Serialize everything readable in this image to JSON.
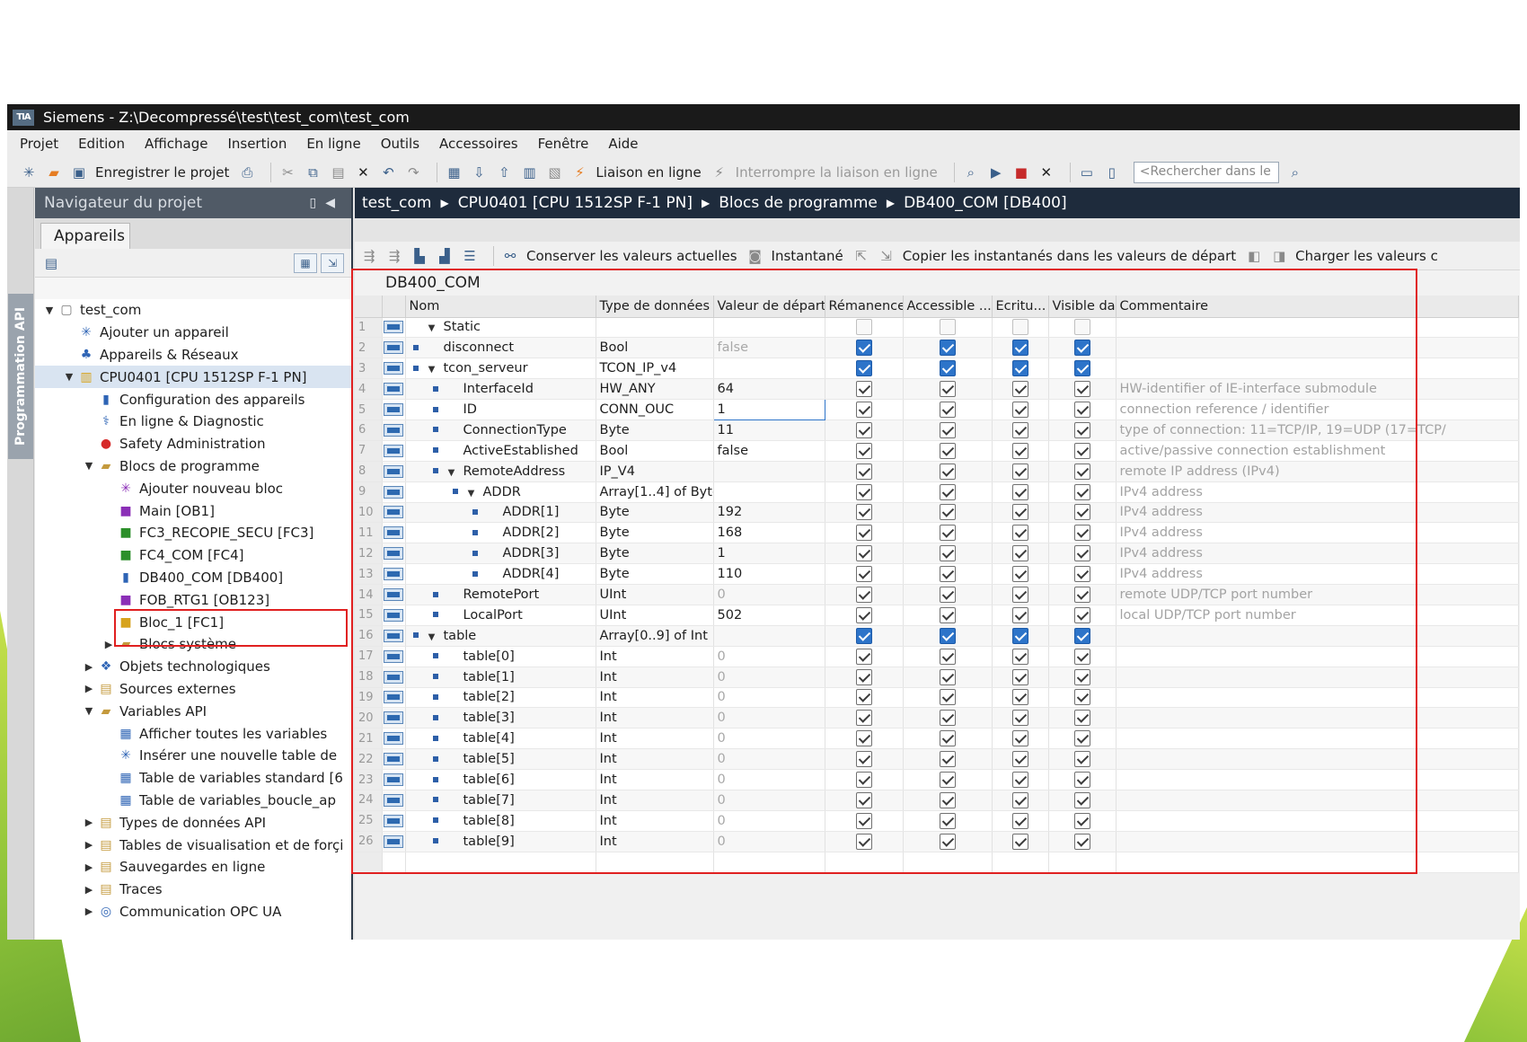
{
  "window": {
    "title": "Siemens  -  Z:\\Decompressé\\test\\test_com\\test_com",
    "logo": "TIA"
  },
  "menu": [
    "Projet",
    "Edition",
    "Affichage",
    "Insertion",
    "En ligne",
    "Outils",
    "Accessoires",
    "Fenêtre",
    "Aide"
  ],
  "toolbar": {
    "save_label": "Enregistrer le projet",
    "online_label": "Liaison en ligne",
    "offline_label": "Interrompre la liaison en ligne",
    "search_placeholder": "<Rechercher dans le"
  },
  "side_tab": {
    "label": "Programmation API"
  },
  "navigator": {
    "title": "Navigateur du projet",
    "tab": "Appareils",
    "tree": [
      {
        "label": "test_com",
        "level": 0,
        "arrow": "down",
        "icon": "project-icon"
      },
      {
        "label": "Ajouter un appareil",
        "level": 1,
        "arrow": "",
        "icon": "add-device-icon"
      },
      {
        "label": "Appareils & Réseaux",
        "level": 1,
        "arrow": "",
        "icon": "network-icon"
      },
      {
        "label": "CPU0401 [CPU 1512SP F-1 PN]",
        "level": 1,
        "arrow": "down",
        "icon": "cpu-icon",
        "selected": true
      },
      {
        "label": "Configuration des appareils",
        "level": 2,
        "arrow": "",
        "icon": "config-icon"
      },
      {
        "label": "En ligne & Diagnostic",
        "level": 2,
        "arrow": "",
        "icon": "diagnostic-icon"
      },
      {
        "label": "Safety Administration",
        "level": 2,
        "arrow": "",
        "icon": "safety-icon"
      },
      {
        "label": "Blocs de programme",
        "level": 2,
        "arrow": "down",
        "icon": "folder-icon"
      },
      {
        "label": "Ajouter nouveau bloc",
        "level": 3,
        "arrow": "",
        "icon": "add-block-icon"
      },
      {
        "label": "Main [OB1]",
        "level": 3,
        "arrow": "",
        "icon": "ob-icon"
      },
      {
        "label": "FC3_RECOPIE_SECU [FC3]",
        "level": 3,
        "arrow": "",
        "icon": "fc-icon"
      },
      {
        "label": "FC4_COM [FC4]",
        "level": 3,
        "arrow": "",
        "icon": "fc-icon"
      },
      {
        "label": "DB400_COM [DB400]",
        "level": 3,
        "arrow": "",
        "icon": "db-icon",
        "highlight": true
      },
      {
        "label": "FOB_RTG1 [OB123]",
        "level": 3,
        "arrow": "",
        "icon": "ob-icon"
      },
      {
        "label": "Bloc_1 [FC1]",
        "level": 3,
        "arrow": "",
        "icon": "fc-safety-icon"
      },
      {
        "label": "Blocs système",
        "level": 3,
        "arrow": "right",
        "icon": "folder-icon"
      },
      {
        "label": "Objets technologiques",
        "level": 2,
        "arrow": "right",
        "icon": "tech-objects-icon"
      },
      {
        "label": "Sources externes",
        "level": 2,
        "arrow": "right",
        "icon": "external-sources-icon"
      },
      {
        "label": "Variables API",
        "level": 2,
        "arrow": "down",
        "icon": "folder-icon"
      },
      {
        "label": "Afficher toutes les variables",
        "level": 3,
        "arrow": "",
        "icon": "variables-icon"
      },
      {
        "label": "Insérer une nouvelle table de",
        "level": 3,
        "arrow": "",
        "icon": "add-table-icon"
      },
      {
        "label": "Table de variables standard [6",
        "level": 3,
        "arrow": "",
        "icon": "var-table-icon"
      },
      {
        "label": "Table de variables_boucle_ap",
        "level": 3,
        "arrow": "",
        "icon": "var-table-icon"
      },
      {
        "label": "Types de données API",
        "level": 2,
        "arrow": "right",
        "icon": "datatypes-icon"
      },
      {
        "label": "Tables de visualisation et de forçi",
        "level": 2,
        "arrow": "right",
        "icon": "watch-table-icon"
      },
      {
        "label": "Sauvegardes en ligne",
        "level": 2,
        "arrow": "right",
        "icon": "backup-icon"
      },
      {
        "label": "Traces",
        "level": 2,
        "arrow": "right",
        "icon": "traces-icon"
      },
      {
        "label": "Communication OPC UA",
        "level": 2,
        "arrow": "right",
        "icon": "opcua-icon"
      }
    ]
  },
  "editor": {
    "breadcrumb": [
      "test_com",
      "CPU0401 [CPU 1512SP F-1 PN]",
      "Blocs de programme",
      "DB400_COM [DB400]"
    ],
    "toolbar": {
      "keep_values": "Conserver les valeurs actuelles",
      "snapshot": "Instantané",
      "copy_snapshots": "Copier les instantanés dans les valeurs de départ",
      "load_values": "Charger les valeurs c"
    },
    "db_title": "DB400_COM",
    "columns": [
      "Nom",
      "Type de données",
      "Valeur de départ",
      "Rémanence",
      "Accessible ...",
      "Ecritu...",
      "Visible da.",
      "Commentaire"
    ],
    "rows": [
      {
        "n": "1",
        "indent": 0,
        "bullet": false,
        "exp": "down",
        "name": "Static",
        "type": "",
        "val": "",
        "valDim": false,
        "cb": "off",
        "comment": ""
      },
      {
        "n": "2",
        "indent": 0,
        "bullet": true,
        "exp": "",
        "name": "disconnect",
        "type": "Bool",
        "val": "false",
        "valDim": true,
        "cb": "blue",
        "comment": ""
      },
      {
        "n": "3",
        "indent": 0,
        "bullet": true,
        "exp": "down",
        "name": "tcon_serveur",
        "type": "TCON_IP_v4",
        "val": "",
        "valDim": false,
        "cb": "blue",
        "comment": ""
      },
      {
        "n": "4",
        "indent": 1,
        "bullet": true,
        "exp": "",
        "name": "InterfaceId",
        "type": "HW_ANY",
        "val": "64",
        "valDim": false,
        "cb": "on",
        "comment": "HW-identifier of IE-interface submodule"
      },
      {
        "n": "5",
        "indent": 1,
        "bullet": true,
        "exp": "",
        "name": "ID",
        "type": "CONN_OUC",
        "val": "1",
        "valDim": false,
        "cb": "on",
        "comment": "connection reference / identifier",
        "editing": true
      },
      {
        "n": "6",
        "indent": 1,
        "bullet": true,
        "exp": "",
        "name": "ConnectionType",
        "type": "Byte",
        "val": "11",
        "valDim": false,
        "cb": "on",
        "comment": "type of connection: 11=TCP/IP, 19=UDP (17=TCP/"
      },
      {
        "n": "7",
        "indent": 1,
        "bullet": true,
        "exp": "",
        "name": "ActiveEstablished",
        "type": "Bool",
        "val": "false",
        "valDim": false,
        "cb": "on",
        "comment": "active/passive connection establishment"
      },
      {
        "n": "8",
        "indent": 1,
        "bullet": true,
        "exp": "down",
        "name": "RemoteAddress",
        "type": "IP_V4",
        "val": "",
        "valDim": false,
        "cb": "on",
        "comment": "remote IP address (IPv4)"
      },
      {
        "n": "9",
        "indent": 2,
        "bullet": true,
        "exp": "down",
        "name": "ADDR",
        "type": "Array[1..4] of Byte",
        "val": "",
        "valDim": false,
        "cb": "on",
        "comment": "IPv4 address"
      },
      {
        "n": "10",
        "indent": 3,
        "bullet": true,
        "exp": "",
        "name": "ADDR[1]",
        "type": "Byte",
        "val": "192",
        "valDim": false,
        "cb": "on",
        "comment": "IPv4 address"
      },
      {
        "n": "11",
        "indent": 3,
        "bullet": true,
        "exp": "",
        "name": "ADDR[2]",
        "type": "Byte",
        "val": "168",
        "valDim": false,
        "cb": "on",
        "comment": "IPv4 address"
      },
      {
        "n": "12",
        "indent": 3,
        "bullet": true,
        "exp": "",
        "name": "ADDR[3]",
        "type": "Byte",
        "val": "1",
        "valDim": false,
        "cb": "on",
        "comment": "IPv4 address"
      },
      {
        "n": "13",
        "indent": 3,
        "bullet": true,
        "exp": "",
        "name": "ADDR[4]",
        "type": "Byte",
        "val": "110",
        "valDim": false,
        "cb": "on",
        "comment": "IPv4 address"
      },
      {
        "n": "14",
        "indent": 1,
        "bullet": true,
        "exp": "",
        "name": "RemotePort",
        "type": "UInt",
        "val": "0",
        "valDim": true,
        "cb": "on",
        "comment": "remote UDP/TCP port number"
      },
      {
        "n": "15",
        "indent": 1,
        "bullet": true,
        "exp": "",
        "name": "LocalPort",
        "type": "UInt",
        "val": "502",
        "valDim": false,
        "cb": "on",
        "comment": "local UDP/TCP port number"
      },
      {
        "n": "16",
        "indent": 0,
        "bullet": true,
        "exp": "down",
        "name": "table",
        "type": "Array[0..9] of Int",
        "val": "",
        "valDim": false,
        "cb": "blue",
        "comment": ""
      },
      {
        "n": "17",
        "indent": 1,
        "bullet": true,
        "exp": "",
        "name": "table[0]",
        "type": "Int",
        "val": "0",
        "valDim": true,
        "cb": "on",
        "comment": ""
      },
      {
        "n": "18",
        "indent": 1,
        "bullet": true,
        "exp": "",
        "name": "table[1]",
        "type": "Int",
        "val": "0",
        "valDim": true,
        "cb": "on",
        "comment": ""
      },
      {
        "n": "19",
        "indent": 1,
        "bullet": true,
        "exp": "",
        "name": "table[2]",
        "type": "Int",
        "val": "0",
        "valDim": true,
        "cb": "on",
        "comment": ""
      },
      {
        "n": "20",
        "indent": 1,
        "bullet": true,
        "exp": "",
        "name": "table[3]",
        "type": "Int",
        "val": "0",
        "valDim": true,
        "cb": "on",
        "comment": ""
      },
      {
        "n": "21",
        "indent": 1,
        "bullet": true,
        "exp": "",
        "name": "table[4]",
        "type": "Int",
        "val": "0",
        "valDim": true,
        "cb": "on",
        "comment": ""
      },
      {
        "n": "22",
        "indent": 1,
        "bullet": true,
        "exp": "",
        "name": "table[5]",
        "type": "Int",
        "val": "0",
        "valDim": true,
        "cb": "on",
        "comment": ""
      },
      {
        "n": "23",
        "indent": 1,
        "bullet": true,
        "exp": "",
        "name": "table[6]",
        "type": "Int",
        "val": "0",
        "valDim": true,
        "cb": "on",
        "comment": ""
      },
      {
        "n": "24",
        "indent": 1,
        "bullet": true,
        "exp": "",
        "name": "table[7]",
        "type": "Int",
        "val": "0",
        "valDim": true,
        "cb": "on",
        "comment": ""
      },
      {
        "n": "25",
        "indent": 1,
        "bullet": true,
        "exp": "",
        "name": "table[8]",
        "type": "Int",
        "val": "0",
        "valDim": true,
        "cb": "on",
        "comment": ""
      },
      {
        "n": "26",
        "indent": 1,
        "bullet": true,
        "exp": "",
        "name": "table[9]",
        "type": "Int",
        "val": "0",
        "valDim": true,
        "cb": "on",
        "comment": ""
      }
    ]
  },
  "colors": {
    "breadcrumb_bg": "#1e2b3c",
    "highlight_red": "#e02020",
    "checkbox_blue": "#2d74c9",
    "titlebar_bg": "#1a1a1a"
  }
}
